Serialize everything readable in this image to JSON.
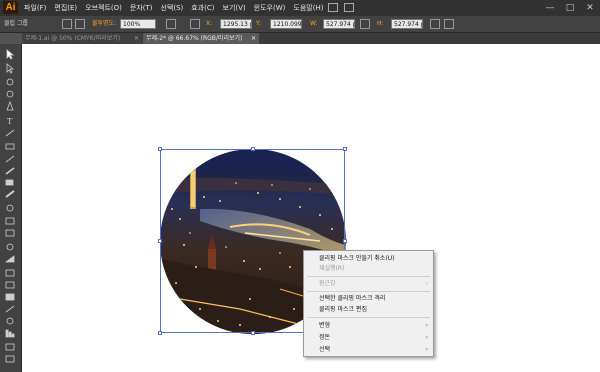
{
  "app": {
    "logo": "Ai"
  },
  "menubar": {
    "items": [
      "파일(F)",
      "편집(E)",
      "오브젝트(O)",
      "문자(T)",
      "선택(S)",
      "효과(C)",
      "보기(V)",
      "윈도우(W)",
      "도움말(H)"
    ],
    "icons": [
      "bridge-icon",
      "arrange-documents-icon"
    ],
    "window_controls": [
      "—",
      "□",
      "✕"
    ]
  },
  "controlbar": {
    "group_label": "클립 그룹",
    "opacity_label": "불투명도:",
    "opacity_value": "100%",
    "x_label": "X:",
    "x_value": "1295.13 px",
    "y_label": "Y:",
    "y_value": "1210.099 px",
    "w_label": "W:",
    "w_value": "527.974 px",
    "h_label": "H:",
    "h_value": "527.974 px"
  },
  "tabs": [
    {
      "label": "무제-1.ai @ 50% (CMYK/미리보기)",
      "close": "✕",
      "active": false
    },
    {
      "label": "무제-2* @ 66.67% (RGB/미리보기)",
      "close": "✕",
      "active": true
    }
  ],
  "context_menu": {
    "release_clipping_mask": "클리핑 마스크 만들기 취소(U)",
    "redo": "재실행(R)",
    "perspective": "원근감",
    "isolate_selected": "선택한 클리핑 마스크 격리",
    "edit_clipping_mask": "클리핑 마스크 편집",
    "transform": "변형",
    "arrange": "정돈",
    "select": "선택",
    "submenu_arrow": "›"
  },
  "colors": {
    "accent": "#ff9a00",
    "selection": "#4f6fe0",
    "canvas_bg": "#ffffff",
    "workspace_bg": "#535353"
  }
}
